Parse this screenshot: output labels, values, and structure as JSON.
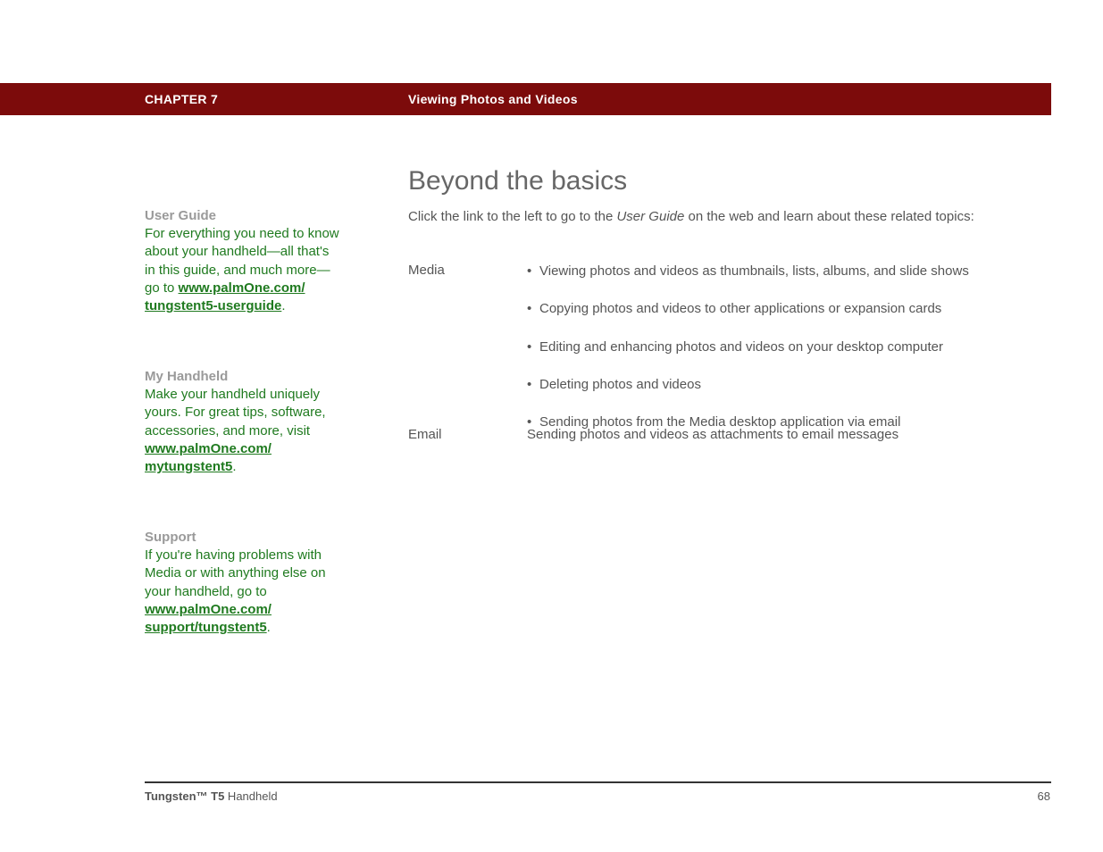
{
  "header": {
    "chapter_label": "CHAPTER 7",
    "chapter_title": "Viewing Photos and Videos"
  },
  "heading": "Beyond the basics",
  "intro": {
    "prefix": "Click the link to the left to go to the ",
    "emph": "User Guide",
    "suffix": " on the web and learn about these related topics:"
  },
  "sidebar": [
    {
      "title": "User Guide",
      "text_before": "For everything you need to know about your handheld—all that's in this guide, and much more—go to ",
      "link_line1": "www.palmOne.com/",
      "link_line2": "tungstent5-userguide",
      "text_after": "."
    },
    {
      "title": "My Handheld",
      "text_before": "Make your handheld uniquely yours. For great tips, software, accessories, and more, visit ",
      "link_line1": "www.palmOne.com/",
      "link_line2": "mytungstent5",
      "text_after": "."
    },
    {
      "title": "Support",
      "text_before": "If you're having problems with Media or with anything else on your handheld, go to ",
      "link_line1": "www.palmOne.com/",
      "link_line2": "support/tungstent5",
      "text_after": "."
    }
  ],
  "topics": {
    "media": {
      "label": "Media",
      "items": [
        "Viewing photos and videos as thumbnails, lists, albums, and slide shows",
        "Copying photos and videos to other applications or expansion cards",
        "Editing and enhancing photos and videos on your desktop computer",
        "Deleting photos and videos",
        "Sending photos from the Media desktop application via email"
      ]
    },
    "email": {
      "label": "Email",
      "text": "Sending photos and videos as attachments to email messages"
    }
  },
  "footer": {
    "product_bold": "Tungsten™ T5",
    "product_rest": " Handheld",
    "page": "68"
  }
}
